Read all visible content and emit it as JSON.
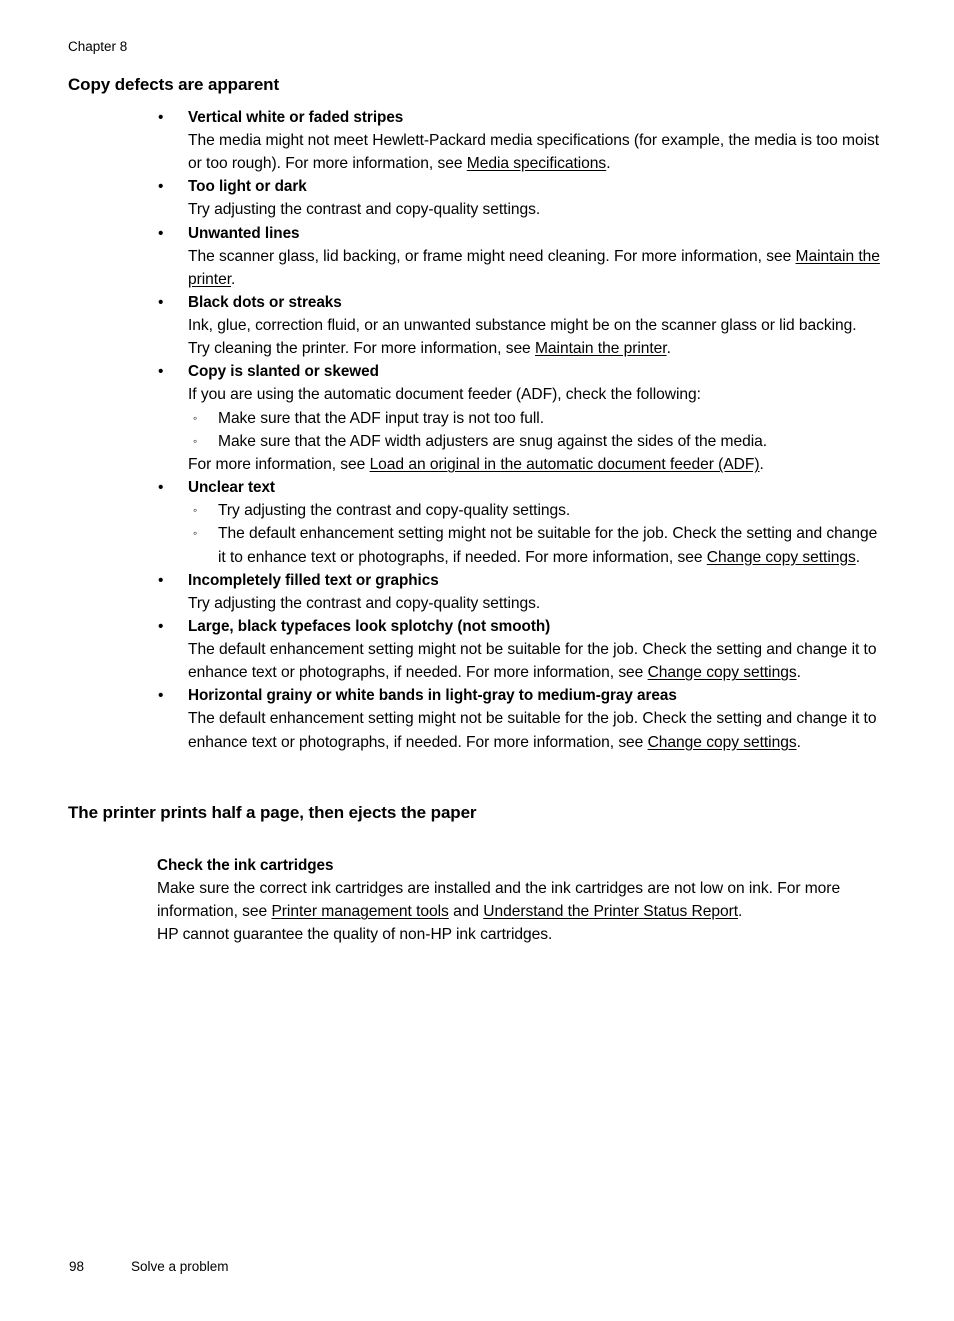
{
  "header": {
    "chapter": "Chapter 8"
  },
  "footer": {
    "page_number": "98",
    "title": "Solve a problem"
  },
  "sections": [
    {
      "heading": "Copy defects are apparent",
      "bullets": [
        {
          "title": "Vertical white or faded stripes",
          "body_1": "The media might not meet Hewlett-Packard media specifications (for example, the media is too moist or too rough). For more information, see ",
          "link_1": "Media specifications",
          "body_2": "."
        },
        {
          "title": "Too light or dark",
          "body_1": "Try adjusting the contrast and copy-quality settings."
        },
        {
          "title": "Unwanted lines",
          "body_1": "The scanner glass, lid backing, or frame might need cleaning. For more information, see ",
          "link_1": "Maintain the printer",
          "body_2": "."
        },
        {
          "title": "Black dots or streaks",
          "body_1": "Ink, glue, correction fluid, or an unwanted substance might be on the scanner glass or lid backing. Try cleaning the printer. For more information, see ",
          "link_1": "Maintain the printer",
          "body_2": "."
        },
        {
          "title": "Copy is slanted or skewed",
          "body_1": "If you are using the automatic document feeder (ADF), check the following:",
          "sub_items": [
            "Make sure that the ADF input tray is not too full.",
            "Make sure that the ADF width adjusters are snug against the sides of the media."
          ],
          "body_2": "For more information, see ",
          "link_2": "Load an original in the automatic document feeder (ADF)",
          "body_3": "."
        },
        {
          "title": "Unclear text",
          "sub_items": [
            "Try adjusting the contrast and copy-quality settings."
          ],
          "sub_rich_pre": "The default enhancement setting might not be suitable for the job. Check the setting and change it to enhance text or photographs, if needed. For more information, see ",
          "sub_rich_link": "Change copy settings",
          "sub_rich_post": "."
        },
        {
          "title": "Incompletely filled text or graphics",
          "body_1": "Try adjusting the contrast and copy-quality settings."
        },
        {
          "title": "Large, black typefaces look splotchy (not smooth)",
          "body_1": "The default enhancement setting might not be suitable for the job. Check the setting and change it to enhance text or photographs, if needed. For more information, see ",
          "link_1": "Change copy settings",
          "body_2": "."
        },
        {
          "title": "Horizontal grainy or white bands in light-gray to medium-gray areas",
          "body_1": "The default enhancement setting might not be suitable for the job. Check the setting and change it to enhance text or photographs, if needed. For more information, see ",
          "link_1": "Change copy settings",
          "body_2": "."
        }
      ]
    },
    {
      "heading": "The printer prints half a page, then ejects the paper",
      "subsection": {
        "title": "Check the ink cartridges",
        "body_pre": "Make sure the correct ink cartridges are installed and the ink cartridges are not low on ink. For more information, see ",
        "link_1": "Printer management tools",
        "body_mid": " and ",
        "link_2": "Understand the Printer Status Report",
        "body_post": ".",
        "body_last": "HP cannot guarantee the quality of non-HP ink cartridges."
      }
    }
  ],
  "markers": {
    "bullet": "•",
    "subbullet": "◦"
  }
}
